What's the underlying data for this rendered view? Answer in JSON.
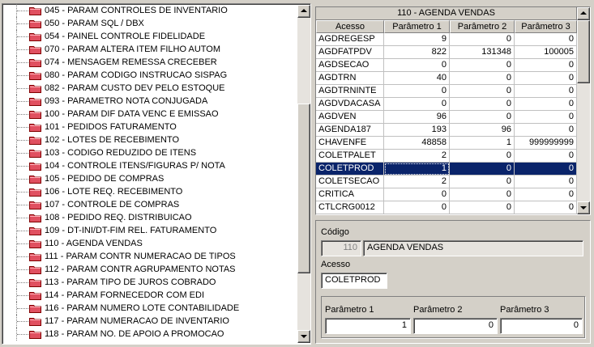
{
  "tree": {
    "items": [
      "045 - PARAM CONTROLES DE INVENTARIO",
      "050 - PARAM SQL / DBX",
      "054 - PAINEL CONTROLE FIDELIDADE",
      "070 - PARAM ALTERA ITEM FILHO AUTOM",
      "074 - MENSAGEM REMESSA CRECEBER",
      "080 - PARAM CODIGO INSTRUCAO SISPAG",
      "082 - PARAM CUSTO DEV PELO ESTOQUE",
      "093 - PARAMETRO NOTA CONJUGADA",
      "100 - PARAM DIF DATA VENC E EMISSAO",
      "101 - PEDIDOS FATURAMENTO",
      "102 - LOTES DE RECEBIMENTO",
      "103 - CODIGO REDUZIDO DE ITENS",
      "104 - CONTROLE ITENS/FIGURAS P/ NOTA",
      "105 - PEDIDO DE COMPRAS",
      "106 - LOTE REQ. RECEBIMENTO",
      "107 - CONTROLE DE COMPRAS",
      "108 - PEDIDO REQ. DISTRIBUICAO",
      "109 - DT-INI/DT-FIM REL. FATURAMENTO",
      "110 - AGENDA VENDAS",
      "111 - PARAM CONTR NUMERACAO DE TIPOS",
      "112 - PARAM CONTR AGRUPAMENTO NOTAS",
      "113 - PARAM TIPO DE JUROS COBRADO",
      "114 - PARAM FORNECEDOR COM EDI",
      "116 - PARAM NUMERO LOTE CONTABILIDADE",
      "117 - PARAM NUMERACAO DE INVENTARIO",
      "118 - PARAM NO. DE APOIO A PROMOCAO"
    ],
    "icon": "folder-icon",
    "icon_color": "#e05060"
  },
  "grid": {
    "title": "110 - AGENDA VENDAS",
    "columns": [
      "Acesso",
      "Parâmetro 1",
      "Parâmetro 2",
      "Parâmetro 3"
    ],
    "rows": [
      [
        "AGDREGESP",
        "9",
        "0",
        "0"
      ],
      [
        "AGDFATPDV",
        "822",
        "131348",
        "100005"
      ],
      [
        "AGDSECAO",
        "0",
        "0",
        "0"
      ],
      [
        "AGDTRN",
        "40",
        "0",
        "0"
      ],
      [
        "AGDTRNINTE",
        "0",
        "0",
        "0"
      ],
      [
        "AGDVDACASA",
        "0",
        "0",
        "0"
      ],
      [
        "AGDVEN",
        "96",
        "0",
        "0"
      ],
      [
        "AGENDA187",
        "193",
        "96",
        "0"
      ],
      [
        "CHAVENFE",
        "48858",
        "1",
        "999999999"
      ],
      [
        "COLETPALET",
        "2",
        "0",
        "0"
      ],
      [
        "COLETPROD",
        "1",
        "0",
        "0"
      ],
      [
        "COLETSECAO",
        "2",
        "0",
        "0"
      ],
      [
        "CRITICA",
        "0",
        "0",
        "0"
      ],
      [
        "CTLCRG0012",
        "0",
        "0",
        "0"
      ]
    ],
    "selected_row": 10,
    "selection_color": "#0a246a"
  },
  "form": {
    "codigo_label": "Código",
    "codigo_value": "110",
    "descricao_value": "AGENDA VENDAS",
    "acesso_label": "Acesso",
    "acesso_value": "COLETPROD",
    "param1_label": "Parâmetro 1",
    "param1_value": "1",
    "param2_label": "Parâmetro 2",
    "param2_value": "0",
    "param3_label": "Parâmetro 3",
    "param3_value": "0"
  }
}
